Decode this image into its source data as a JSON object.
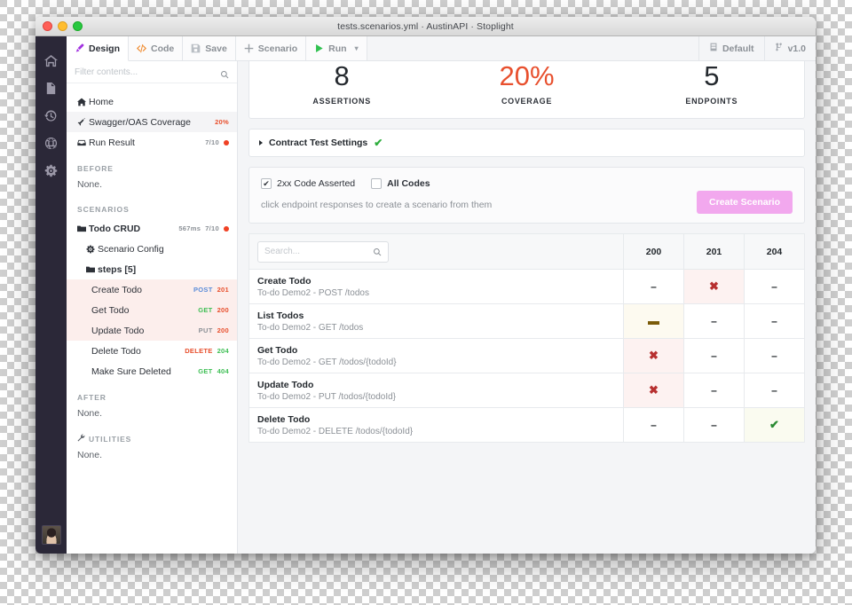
{
  "window": {
    "title": "tests.scenarios.yml · AustinAPI · Stoplight",
    "traffic": {
      "close": "close-button",
      "minimize": "minimize-button",
      "zoom": "zoom-button"
    }
  },
  "rail": {
    "items": [
      {
        "name": "home-icon",
        "label": "Home"
      },
      {
        "name": "file-icon",
        "label": "Files"
      },
      {
        "name": "history-icon",
        "label": "History"
      },
      {
        "name": "globe-icon",
        "label": "Explore"
      },
      {
        "name": "gear-icon",
        "label": "Settings"
      }
    ],
    "avatar_label": "User avatar"
  },
  "toolbar": {
    "tabs": [
      {
        "label": "Design",
        "icon": "brush-icon",
        "active": true
      },
      {
        "label": "Code",
        "icon": "code-icon",
        "active": false
      },
      {
        "label": "Save",
        "icon": "save-icon",
        "active": false
      },
      {
        "label": "Scenario",
        "icon": "plus-icon",
        "active": false
      },
      {
        "label": "Run",
        "icon": "play-icon",
        "active": false
      }
    ],
    "run_caret": "▾",
    "right": [
      {
        "label": "Default",
        "icon": "database-icon"
      },
      {
        "label": "v1.0",
        "icon": "branch-icon"
      }
    ]
  },
  "sidebar": {
    "filter_placeholder": "Filter contents...",
    "top_items": [
      {
        "label": "Home",
        "icon": "home-icon",
        "meta": "",
        "badge": "",
        "selected": false
      },
      {
        "label": "Swagger/OAS Coverage",
        "icon": "rocket-icon",
        "meta": "20%",
        "meta_color": "#e8502e",
        "badge": "",
        "selected": true
      },
      {
        "label": "Run Result",
        "icon": "inbox-icon",
        "meta": "7/10",
        "meta_color": "#8b9096",
        "badge": "#f04124",
        "selected": false
      }
    ],
    "sections": [
      {
        "title": "BEFORE",
        "icon": "",
        "empty_text": "None."
      },
      {
        "title": "AFTER",
        "icon": "",
        "empty_text": "None."
      },
      {
        "title": "UTILITIES",
        "icon": "wrench-icon",
        "empty_text": "None."
      }
    ],
    "scenarios_title": "SCENARIOS",
    "scenario": {
      "label": "Todo CRUD",
      "duration": "567ms",
      "ratio": "7/10",
      "badge": "#f04124",
      "config_label": "Scenario Config",
      "steps_label": "steps [5]",
      "steps": [
        {
          "label": "Create Todo",
          "method": "POST",
          "method_color": "#5b8dd9",
          "code": "201",
          "code_color": "#e8502e",
          "highlight": true
        },
        {
          "label": "Get Todo",
          "method": "GET",
          "method_color": "#3fbf55",
          "code": "200",
          "code_color": "#e8502e",
          "highlight": true
        },
        {
          "label": "Update Todo",
          "method": "PUT",
          "method_color": "#8b9096",
          "code": "200",
          "code_color": "#e8502e",
          "highlight": true
        },
        {
          "label": "Delete Todo",
          "method": "DELETE",
          "method_color": "#e8502e",
          "code": "204",
          "code_color": "#3fbf55",
          "highlight": false
        },
        {
          "label": "Make Sure Deleted",
          "method": "GET",
          "method_color": "#3fbf55",
          "code": "404",
          "code_color": "#3fbf55",
          "highlight": false
        }
      ]
    }
  },
  "main": {
    "stats": [
      {
        "value": "8",
        "caption": "ASSERTIONS",
        "accent": false
      },
      {
        "value": "20%",
        "caption": "COVERAGE",
        "accent": true
      },
      {
        "value": "5",
        "caption": "ENDPOINTS",
        "accent": false
      }
    ],
    "accent_color": "#e8502e",
    "contract": {
      "label": "Contract Test Settings",
      "check": "✔"
    },
    "codes_panel": {
      "checkbox_2xx": {
        "label": "2xx Code Asserted",
        "checked": true
      },
      "checkbox_all": {
        "label": "All Codes",
        "checked": false
      },
      "hint": "click endpoint responses to create a scenario from them",
      "create_button": "Create Scenario",
      "create_button_color": "#f2a8ee"
    },
    "table": {
      "search_placeholder": "Search...",
      "columns": [
        "200",
        "201",
        "204"
      ],
      "rows": [
        {
          "name": "Create Todo",
          "path": "To-do Demo2 - POST /todos",
          "cells": [
            {
              "mark": "–",
              "state": "none"
            },
            {
              "mark": "✖",
              "state": "fail"
            },
            {
              "mark": "–",
              "state": "none"
            }
          ]
        },
        {
          "name": "List Todos",
          "path": "To-do Demo2 - GET /todos",
          "cells": [
            {
              "mark": "▬",
              "state": "warn"
            },
            {
              "mark": "–",
              "state": "none"
            },
            {
              "mark": "–",
              "state": "none"
            }
          ]
        },
        {
          "name": "Get Todo",
          "path": "To-do Demo2 - GET /todos/{todoId}",
          "cells": [
            {
              "mark": "✖",
              "state": "fail"
            },
            {
              "mark": "–",
              "state": "none"
            },
            {
              "mark": "–",
              "state": "none"
            }
          ]
        },
        {
          "name": "Update Todo",
          "path": "To-do Demo2 - PUT /todos/{todoId}",
          "cells": [
            {
              "mark": "✖",
              "state": "fail"
            },
            {
              "mark": "–",
              "state": "none"
            },
            {
              "mark": "–",
              "state": "none"
            }
          ]
        },
        {
          "name": "Delete Todo",
          "path": "To-do Demo2 - DELETE /todos/{todoId}",
          "cells": [
            {
              "mark": "–",
              "state": "none"
            },
            {
              "mark": "–",
              "state": "none"
            },
            {
              "mark": "✔",
              "state": "pass"
            }
          ]
        }
      ]
    }
  }
}
